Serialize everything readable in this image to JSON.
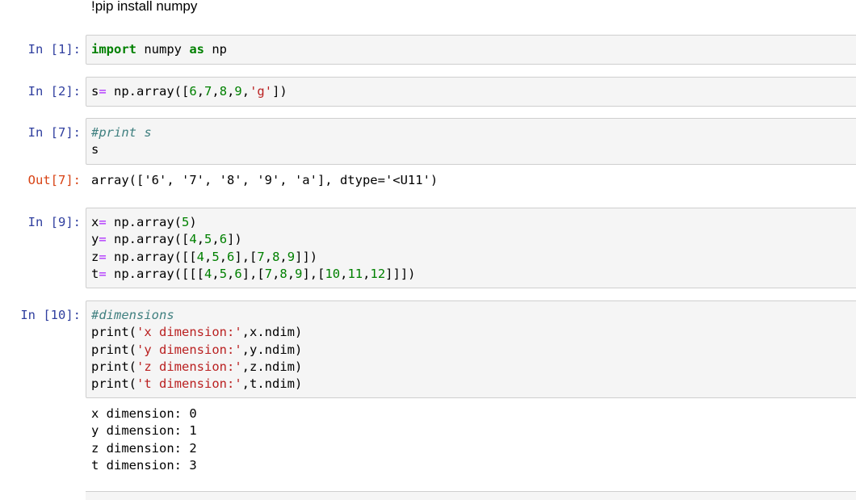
{
  "markdown": {
    "text": "!pip install numpy"
  },
  "cells": [
    {
      "prompt": "In [1]:",
      "lines": [
        [
          "import",
          " numpy ",
          "as",
          " np"
        ]
      ]
    },
    {
      "prompt": "In [2]:",
      "lines": [
        [
          "s",
          "=",
          " np.array([",
          "6",
          ",",
          "7",
          ",",
          "8",
          ",",
          "9",
          ",",
          "'g'",
          "])"
        ]
      ]
    },
    {
      "prompt": "In [7]:",
      "lines": [
        [
          "#print s"
        ],
        [
          "s"
        ]
      ]
    },
    {
      "prompt": "In [9]:",
      "lines": [
        [
          "x",
          "=",
          " np.array(",
          "5",
          ")"
        ],
        [
          "y",
          "=",
          " np.array([",
          "4",
          ",",
          "5",
          ",",
          "6",
          "])"
        ],
        [
          "z",
          "=",
          " np.array([[",
          "4",
          ",",
          "5",
          ",",
          "6",
          "],[",
          "7",
          ",",
          "8",
          ",",
          "9",
          "]])"
        ],
        [
          "t",
          "=",
          " np.array([[[",
          "4",
          ",",
          "5",
          ",",
          "6",
          "],[",
          "7",
          ",",
          "8",
          ",",
          "9",
          "],[",
          "10",
          ",",
          "11",
          ",",
          "12",
          "]]])"
        ]
      ]
    },
    {
      "prompt": "In [10]:",
      "lines": [
        [
          "#dimensions"
        ],
        [
          "print(",
          "'x dimension:'",
          ",x.ndim)"
        ],
        [
          "print(",
          "'y dimension:'",
          ",y.ndim)"
        ],
        [
          "print(",
          "'z dimension:'",
          ",z.ndim)"
        ],
        [
          "print(",
          "'t dimension:'",
          ",t.ndim)"
        ]
      ]
    }
  ],
  "outputs": {
    "out7": {
      "prompt": "Out[7]:",
      "text": "array(['6', '7', '8', '9', 'a'], dtype='<U11')"
    },
    "stream10": {
      "lines": [
        "x dimension: 0",
        "y dimension: 1",
        "z dimension: 2",
        "t dimension: 3"
      ]
    }
  }
}
